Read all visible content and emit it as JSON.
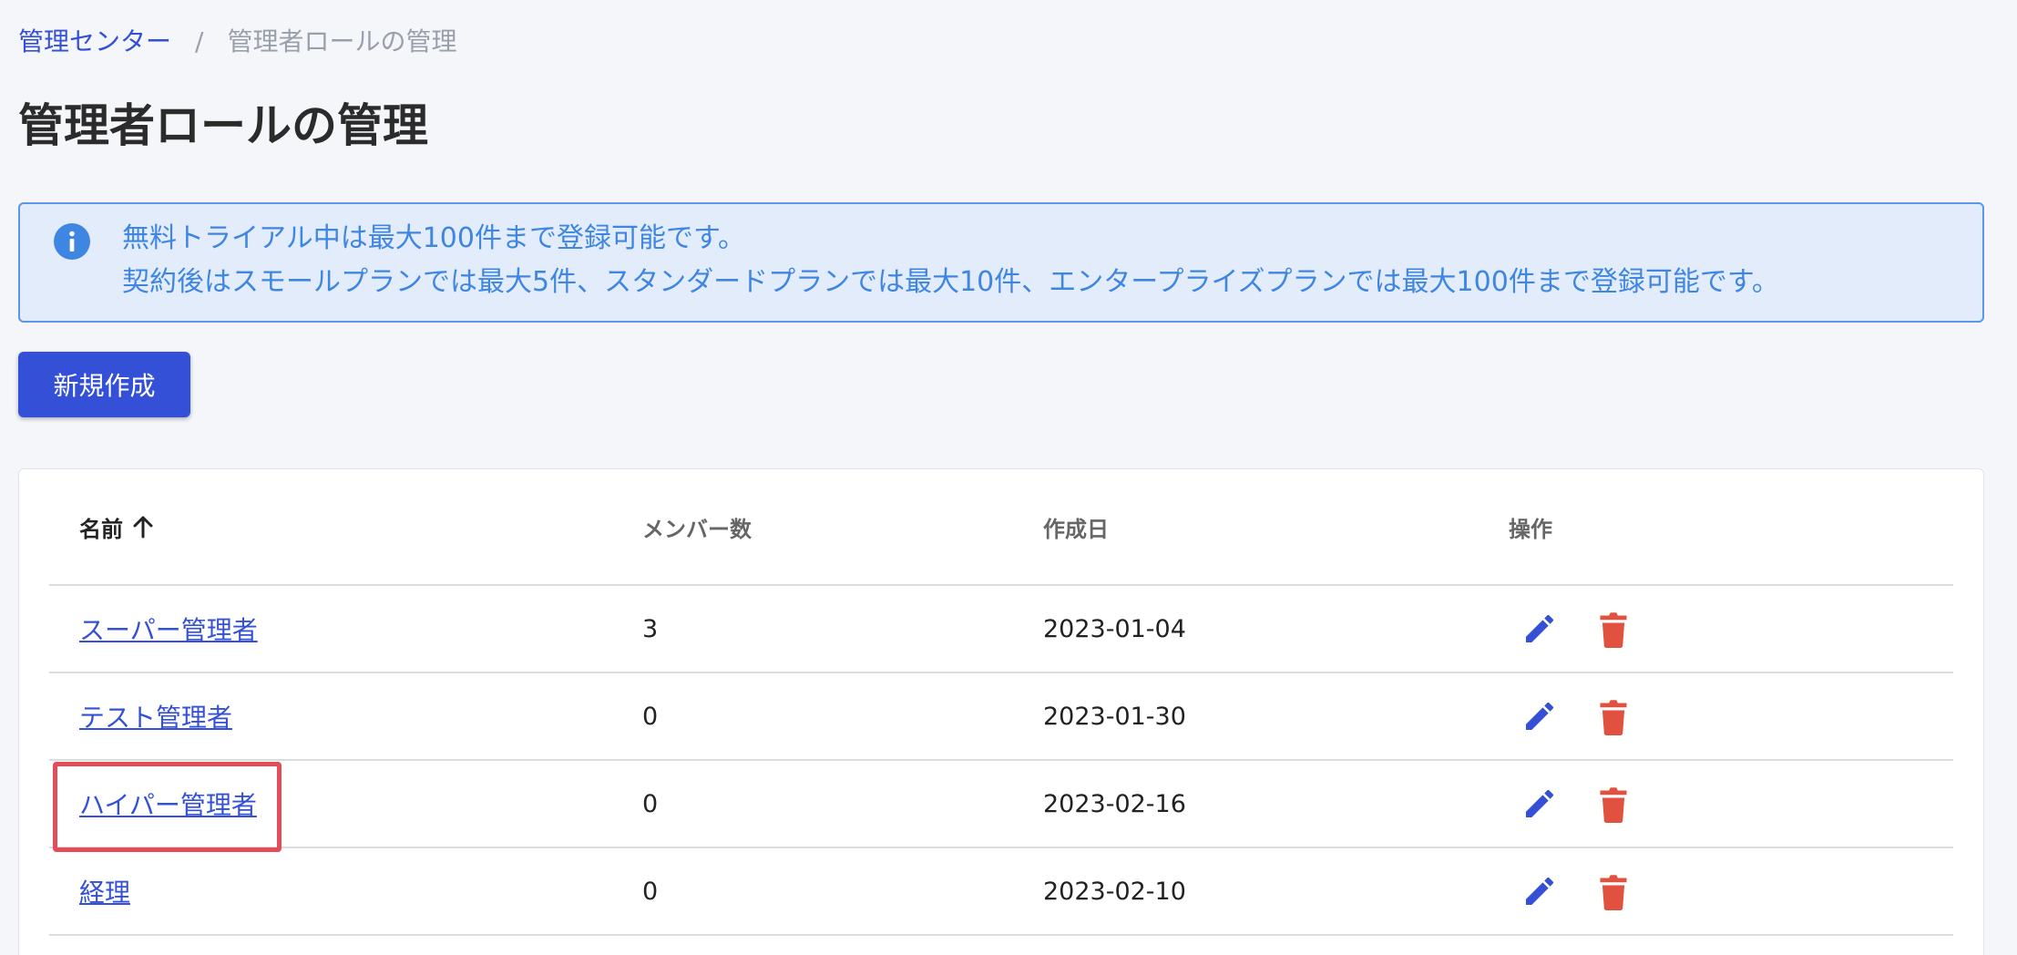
{
  "breadcrumb": {
    "home": "管理センター",
    "separator": "/",
    "current": "管理者ロールの管理"
  },
  "page_title": "管理者ロールの管理",
  "notice": {
    "icon": "info-icon",
    "line1": "無料トライアル中は最大100件まで登録可能です。",
    "line2": "契約後はスモールプランでは最大5件、スタンダードプランでは最大10件、エンタープライズプランでは最大100件まで登録可能です。"
  },
  "new_button_label": "新規作成",
  "table": {
    "headers": {
      "name": "名前",
      "members": "メンバー数",
      "created": "作成日",
      "actions": "操作"
    },
    "sort_icon": "arrow-up-icon",
    "rows": [
      {
        "name": "スーパー管理者",
        "members": "3",
        "created": "2023-01-04"
      },
      {
        "name": "テスト管理者",
        "members": "0",
        "created": "2023-01-30"
      },
      {
        "name": "ハイパー管理者",
        "members": "0",
        "created": "2023-02-16"
      },
      {
        "name": "経理",
        "members": "0",
        "created": "2023-02-10"
      }
    ]
  },
  "colors": {
    "primary": "#3350d6",
    "danger": "#e0523f",
    "info_text": "#3f86e3",
    "info_bg": "#e3ecfa",
    "highlight": "#e34c58"
  }
}
